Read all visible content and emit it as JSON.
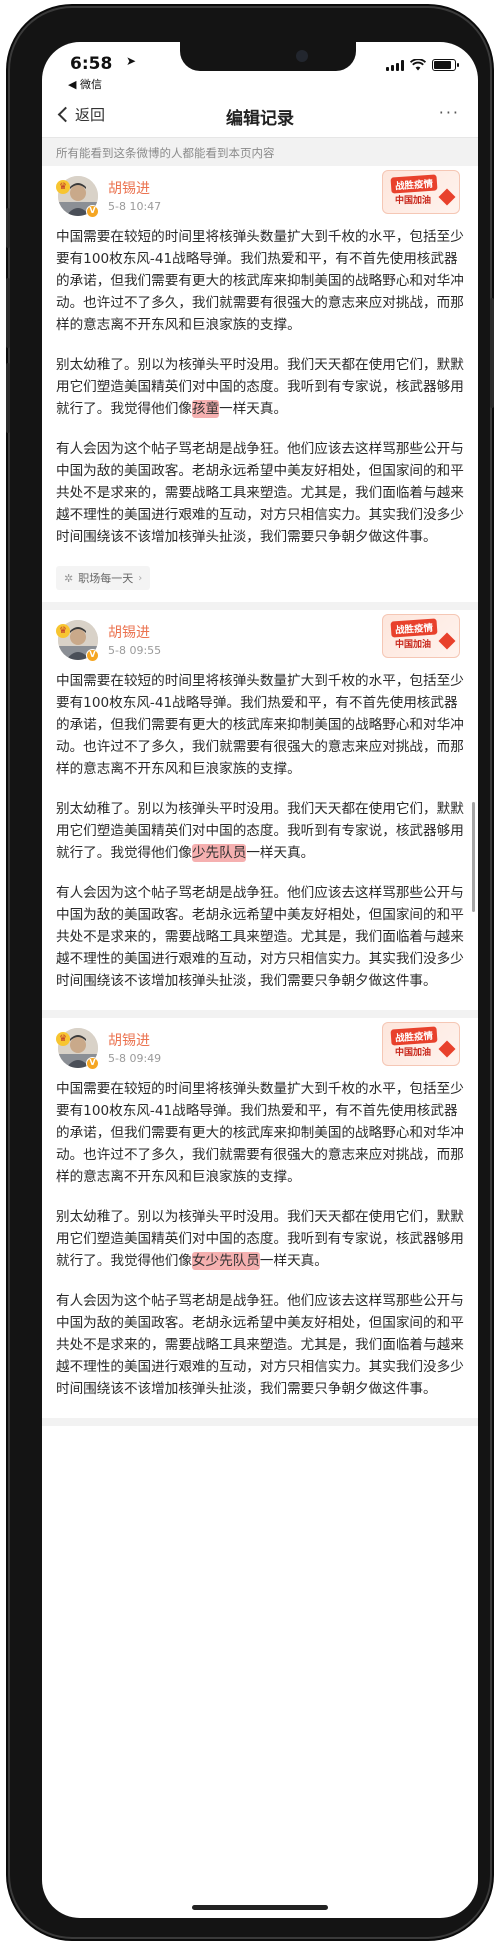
{
  "status_bar": {
    "time": "6:58",
    "location_glyph": "➤",
    "back_app": "◀ 微信",
    "signal_bars": 4,
    "battery_level": 0.85
  },
  "nav": {
    "back_label": "返回",
    "title": "编辑记录",
    "more_label": "···"
  },
  "notice": "所有能看到这条微博的人都能看到本页内容",
  "records": [
    {
      "author": "胡锡进",
      "time": "5-8 10:47",
      "promo_line1": "战胜疫情",
      "promo_line2": "中国加油",
      "p1": "中国需要在较短的时间里将核弹头数量扩大到千枚的水平，包括至少要有100枚东风-41战略导弹。我们热爱和平，有不首先使用核武器的承诺，但我们需要有更大的核武库来抑制美国的战略野心和对华冲动。也许过不了多久，我们就需要有很强大的意志来应对挑战，而那样的意志离不开东风和巨浪家族的支撑。",
      "p2_before": "别太幼稚了。别以为核弹头平时没用。我们天天都在使用它们，默默用它们塑造美国精英们对中国的态度。我听到有专家说，核武器够用就行了。我觉得他们像",
      "p2_highlight": "孩童",
      "p2_after": "一样天真。",
      "p3": "有人会因为这个帖子骂老胡是战争狂。他们应该去这样骂那些公开与中国为敌的美国政客。老胡永远希望中美友好相处，但国家间的和平共处不是求来的，需要战略工具来塑造。尤其是，我们面临着与越来越不理性的美国进行艰难的互动，对方只相信实力。其实我们没多少时间围绕该不该增加核弹头扯淡，我们需要只争朝夕做这件事。",
      "tag": "职场每一天"
    },
    {
      "author": "胡锡进",
      "time": "5-8 09:55",
      "promo_line1": "战胜疫情",
      "promo_line2": "中国加油",
      "p1": "中国需要在较短的时间里将核弹头数量扩大到千枚的水平，包括至少要有100枚东风-41战略导弹。我们热爱和平，有不首先使用核武器的承诺，但我们需要有更大的核武库来抑制美国的战略野心和对华冲动。也许过不了多久，我们就需要有很强大的意志来应对挑战，而那样的意志离不开东风和巨浪家族的支撑。",
      "p2_before": "别太幼稚了。别以为核弹头平时没用。我们天天都在使用它们，默默用它们塑造美国精英们对中国的态度。我听到有专家说，核武器够用就行了。我觉得他们像",
      "p2_highlight": "少先队员",
      "p2_after": "一样天真。",
      "p3": "有人会因为这个帖子骂老胡是战争狂。他们应该去这样骂那些公开与中国为敌的美国政客。老胡永远希望中美友好相处，但国家间的和平共处不是求来的，需要战略工具来塑造。尤其是，我们面临着与越来越不理性的美国进行艰难的互动，对方只相信实力。其实我们没多少时间围绕该不该增加核弹头扯淡，我们需要只争朝夕做这件事。",
      "tag": ""
    },
    {
      "author": "胡锡进",
      "time": "5-8 09:49",
      "promo_line1": "战胜疫情",
      "promo_line2": "中国加油",
      "p1": "中国需要在较短的时间里将核弹头数量扩大到千枚的水平，包括至少要有100枚东风-41战略导弹。我们热爱和平，有不首先使用核武器的承诺，但我们需要有更大的核武库来抑制美国的战略野心和对华冲动。也许过不了多久，我们就需要有很强大的意志来应对挑战，而那样的意志离不开东风和巨浪家族的支撑。",
      "p2_before": "别太幼稚了。别以为核弹头平时没用。我们天天都在使用它们，默默用它们塑造美国精英们对中国的态度。我听到有专家说，核武器够用就行了。我觉得他们像",
      "p2_highlight": "女少先队员",
      "p2_after": "一样天真。",
      "p3": "有人会因为这个帖子骂老胡是战争狂。他们应该去这样骂那些公开与中国为敌的美国政客。老胡永远希望中美友好相处，但国家间的和平共处不是求来的，需要战略工具来塑造。尤其是，我们面临着与越来越不理性的美国进行艰难的互动，对方只相信实力。其实我们没多少时间围绕该不该增加核弹头扯淡，我们需要只争朝夕做这件事。",
      "tag": ""
    }
  ],
  "colors": {
    "author": "#eb7350",
    "highlight": "#f29696",
    "notice_bg": "#f2f2f2"
  }
}
